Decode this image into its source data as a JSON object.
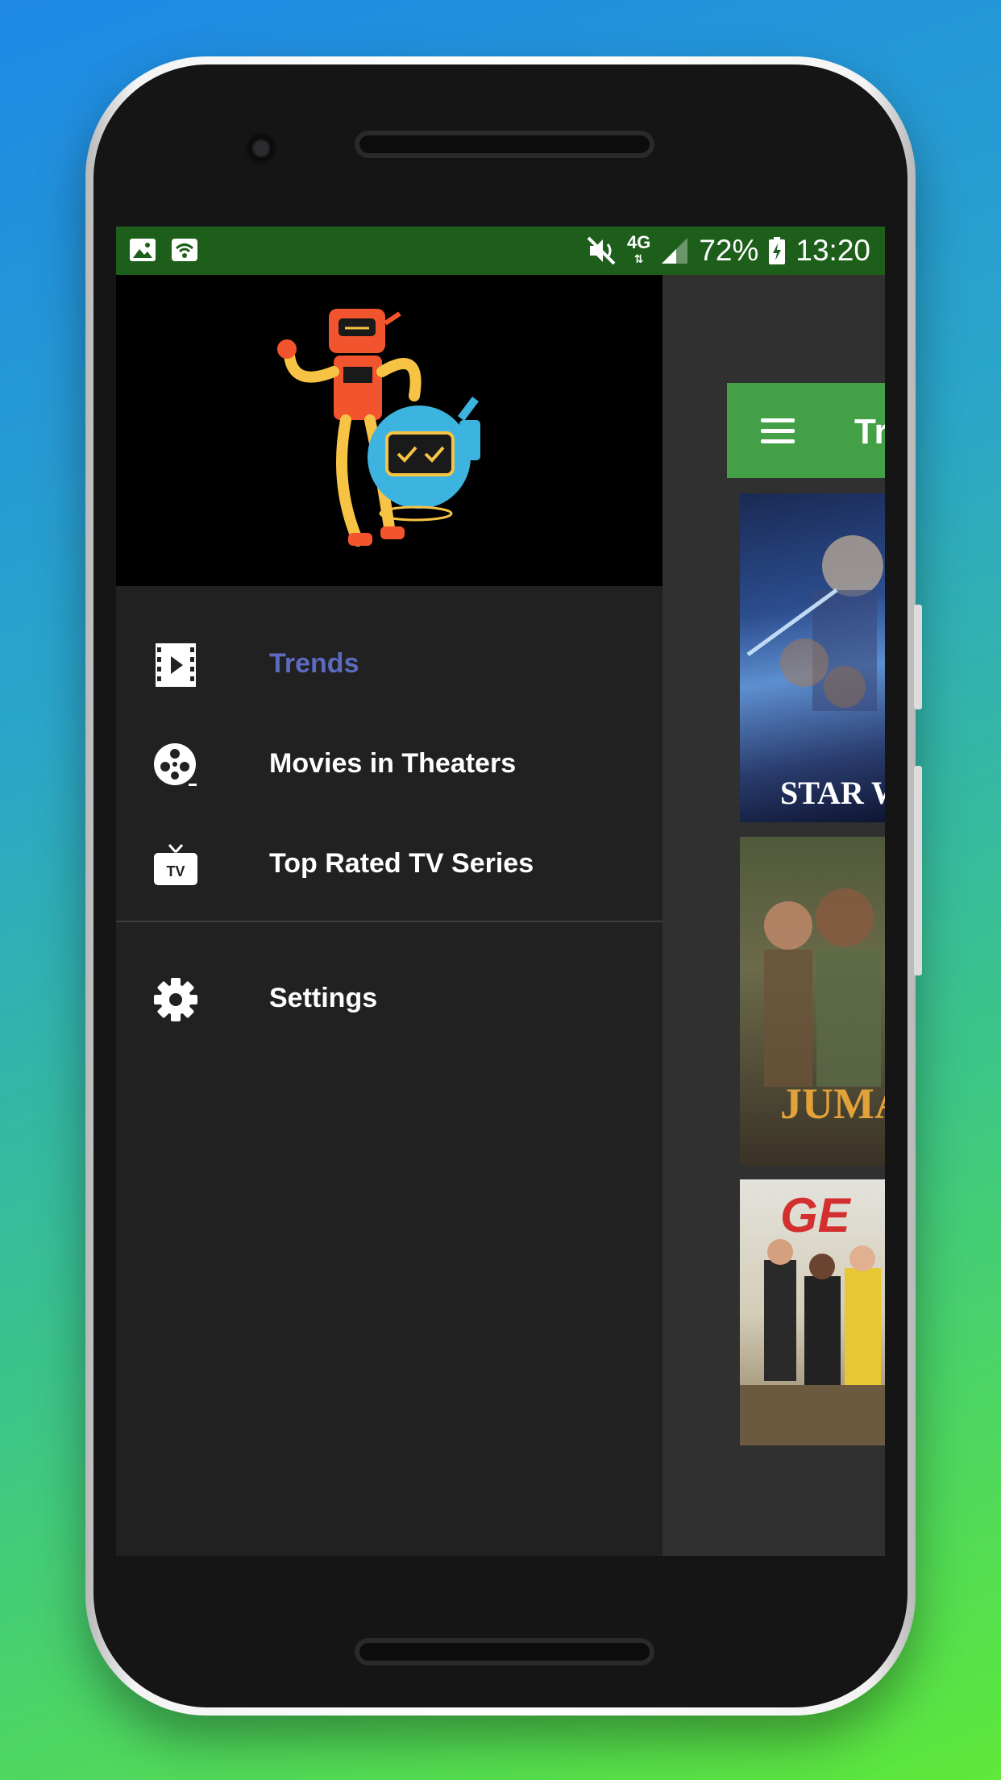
{
  "status_bar": {
    "left_icons": [
      "image-icon",
      "wifi-hotspot-icon"
    ],
    "right_icons": [
      "mute-icon",
      "network-4g-icon",
      "signal-icon",
      "battery-icon"
    ],
    "network": "4G",
    "battery": "72%",
    "time": "13:20",
    "color": "#1d5e1a"
  },
  "drawer": {
    "header_image": "robot-mascot-logo",
    "items": [
      {
        "label": "Trends",
        "icon": "movie-film-icon",
        "active": true
      },
      {
        "label": "Movies in Theaters",
        "icon": "film-reel-icon",
        "active": false
      },
      {
        "label": "Top Rated TV Series",
        "icon": "tv-icon",
        "active": false
      }
    ],
    "settings": {
      "label": "Settings",
      "icon": "gear-icon"
    },
    "active_color": "#5c6bc0"
  },
  "app": {
    "toolbar_title": "Tr",
    "toolbar_color": "#43a047",
    "posters": [
      {
        "caption": "STAR WA"
      },
      {
        "caption": "JUMA"
      },
      {
        "caption": "GE"
      }
    ]
  }
}
